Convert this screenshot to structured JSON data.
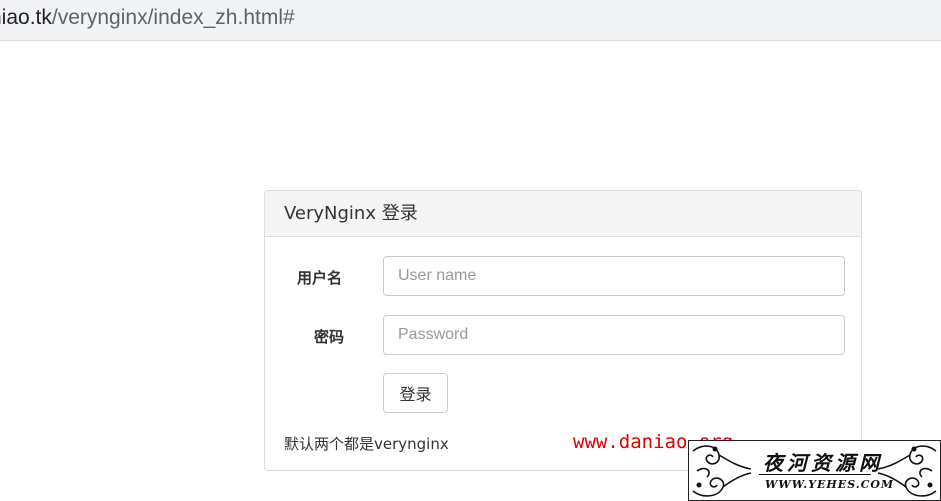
{
  "browser": {
    "url_host": "niao.tk",
    "url_path": "/verynginx/index_zh.html#"
  },
  "login": {
    "title": "VeryNginx 登录",
    "username_label": "用户名",
    "username_placeholder": "User name",
    "password_label": "密码",
    "password_placeholder": "Password",
    "submit_label": "登录",
    "hint": "默认两个都是verynginx"
  },
  "watermark": {
    "url_text": "www.daniao.org",
    "site_name_cn": "夜河资源网",
    "site_domain": "WWW.YEHES.COM",
    "url_color": "#e00000"
  }
}
